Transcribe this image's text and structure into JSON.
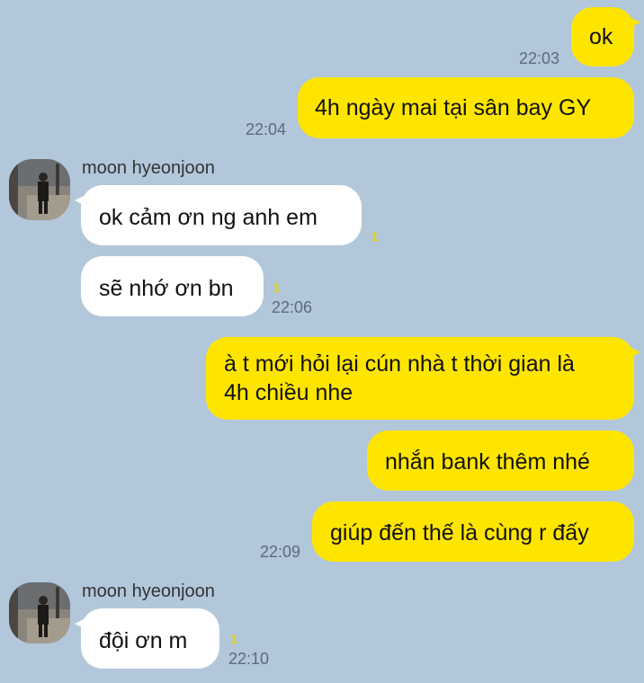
{
  "messages": {
    "m1": {
      "text": "ok",
      "time": "22:03"
    },
    "m2": {
      "text": "4h ngày mai tại sân bay GY",
      "time": "22:04"
    },
    "m3": {
      "sender": "moon hyeonjoon",
      "text": "ok cảm ơn ng anh em",
      "unread": "1"
    },
    "m4": {
      "text": "sẽ nhớ ơn bn",
      "unread": "1",
      "time": "22:06"
    },
    "m5": {
      "line1": "à t mới hỏi lại cún nhà t thời gian là",
      "line2": "4h chiều nhe"
    },
    "m6": {
      "text": "nhắn bank thêm nhé"
    },
    "m7": {
      "text": "giúp đến thế là cùng r đấy",
      "time": "22:09"
    },
    "m8": {
      "sender": "moon hyeonjoon",
      "text": "đội ơn m",
      "unread": "1",
      "time": "22:10"
    }
  },
  "colors": {
    "background": "#b2c7da",
    "outgoing": "#fee500",
    "incoming": "#ffffff"
  }
}
